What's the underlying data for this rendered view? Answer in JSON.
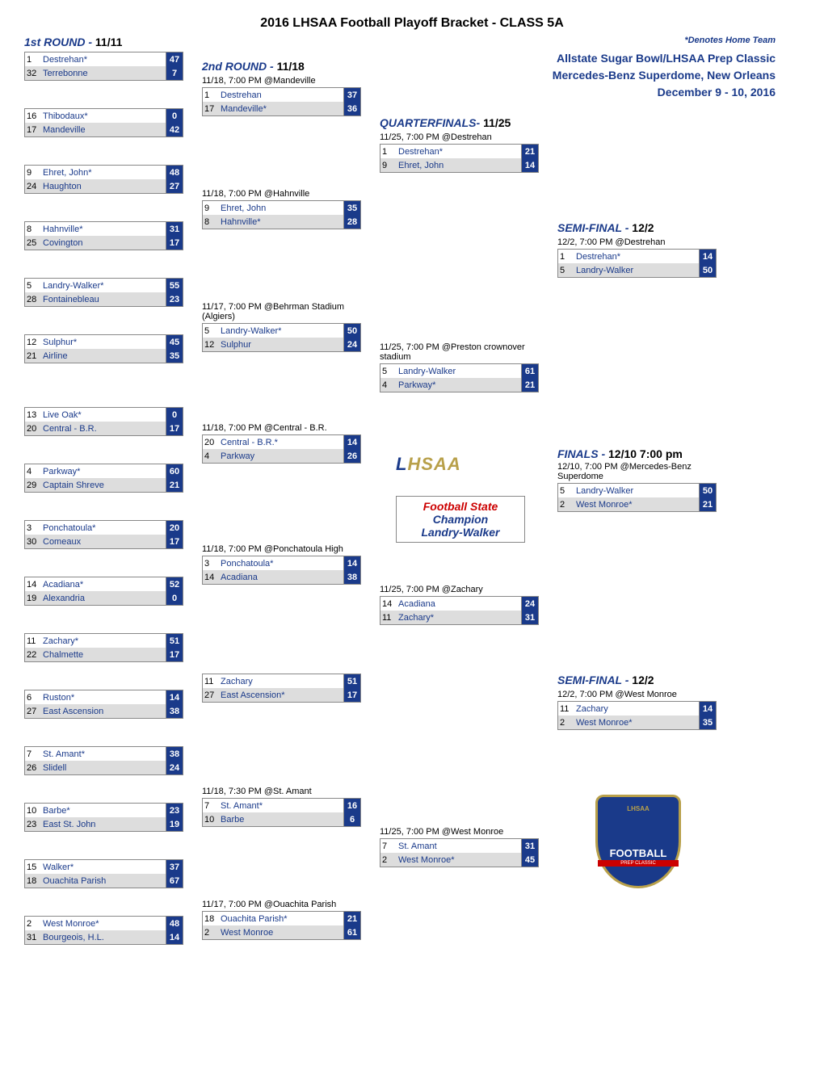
{
  "title": "2016 LHSAA Football Playoff Bracket - CLASS 5A",
  "home_note": "*Denotes Home Team",
  "event": {
    "line1": "Allstate Sugar Bowl/LHSAA Prep Classic",
    "line2": "Mercedes-Benz Superdome, New Orleans",
    "line3": "December 9 - 10, 2016"
  },
  "rounds": {
    "r1": {
      "label": "1st ROUND - ",
      "date": "11/11"
    },
    "r2": {
      "label": "2nd ROUND - ",
      "date": "11/18"
    },
    "qf": {
      "label": "QUARTERFINALS- ",
      "date": "11/25"
    },
    "sf": {
      "label": "SEMI-FINAL - ",
      "date": "12/2"
    },
    "f": {
      "label": "FINALS - ",
      "date": "12/10 7:00 pm"
    }
  },
  "champion": {
    "line1": "Football State",
    "line2": "Champion",
    "line3": "Landry-Walker"
  },
  "r1_games": [
    {
      "t1": {
        "seed": "1",
        "name": "Destrehan*",
        "score": "47"
      },
      "t2": {
        "seed": "32",
        "name": "Terrebonne",
        "score": "7"
      }
    },
    {
      "t1": {
        "seed": "16",
        "name": "Thibodaux*",
        "score": "0"
      },
      "t2": {
        "seed": "17",
        "name": "Mandeville",
        "score": "42"
      }
    },
    {
      "t1": {
        "seed": "9",
        "name": "Ehret, John*",
        "score": "48"
      },
      "t2": {
        "seed": "24",
        "name": "Haughton",
        "score": "27"
      }
    },
    {
      "t1": {
        "seed": "8",
        "name": "Hahnville*",
        "score": "31"
      },
      "t2": {
        "seed": "25",
        "name": "Covington",
        "score": "17"
      }
    },
    {
      "t1": {
        "seed": "5",
        "name": "Landry-Walker*",
        "score": "55"
      },
      "t2": {
        "seed": "28",
        "name": "Fontainebleau",
        "score": "23"
      }
    },
    {
      "t1": {
        "seed": "12",
        "name": "Sulphur*",
        "score": "45"
      },
      "t2": {
        "seed": "21",
        "name": "Airline",
        "score": "35"
      }
    },
    {
      "t1": {
        "seed": "13",
        "name": "Live Oak*",
        "score": "0"
      },
      "t2": {
        "seed": "20",
        "name": "Central - B.R.",
        "score": "17"
      }
    },
    {
      "t1": {
        "seed": "4",
        "name": "Parkway*",
        "score": "60"
      },
      "t2": {
        "seed": "29",
        "name": "Captain Shreve",
        "score": "21"
      }
    },
    {
      "t1": {
        "seed": "3",
        "name": "Ponchatoula*",
        "score": "20"
      },
      "t2": {
        "seed": "30",
        "name": "Comeaux",
        "score": "17"
      }
    },
    {
      "t1": {
        "seed": "14",
        "name": "Acadiana*",
        "score": "52"
      },
      "t2": {
        "seed": "19",
        "name": "Alexandria",
        "score": "0"
      }
    },
    {
      "t1": {
        "seed": "11",
        "name": "Zachary*",
        "score": "51"
      },
      "t2": {
        "seed": "22",
        "name": "Chalmette",
        "score": "17"
      }
    },
    {
      "t1": {
        "seed": "6",
        "name": "Ruston*",
        "score": "14"
      },
      "t2": {
        "seed": "27",
        "name": "East Ascension",
        "score": "38"
      }
    },
    {
      "t1": {
        "seed": "7",
        "name": "St. Amant*",
        "score": "38"
      },
      "t2": {
        "seed": "26",
        "name": "Slidell",
        "score": "24"
      }
    },
    {
      "t1": {
        "seed": "10",
        "name": "Barbe*",
        "score": "23"
      },
      "t2": {
        "seed": "23",
        "name": "East St. John",
        "score": "19"
      }
    },
    {
      "t1": {
        "seed": "15",
        "name": "Walker*",
        "score": "37"
      },
      "t2": {
        "seed": "18",
        "name": "Ouachita Parish",
        "score": "67"
      }
    },
    {
      "t1": {
        "seed": "2",
        "name": "West Monroe*",
        "score": "48"
      },
      "t2": {
        "seed": "31",
        "name": "Bourgeois, H.L.",
        "score": "14"
      }
    }
  ],
  "r2_games": [
    {
      "info": "11/18, 7:00 PM @Mandeville",
      "t1": {
        "seed": "1",
        "name": "Destrehan",
        "score": "37"
      },
      "t2": {
        "seed": "17",
        "name": "Mandeville*",
        "score": "36"
      }
    },
    {
      "info": "11/18, 7:00 PM @Hahnville",
      "t1": {
        "seed": "9",
        "name": "Ehret, John",
        "score": "35"
      },
      "t2": {
        "seed": "8",
        "name": "Hahnville*",
        "score": "28"
      }
    },
    {
      "info": "11/17, 7:00 PM @Behrman Stadium (Algiers)",
      "t1": {
        "seed": "5",
        "name": "Landry-Walker*",
        "score": "50"
      },
      "t2": {
        "seed": "12",
        "name": "Sulphur",
        "score": "24"
      }
    },
    {
      "info": "11/18, 7:00 PM @Central - B.R.",
      "t1": {
        "seed": "20",
        "name": "Central - B.R.*",
        "score": "14"
      },
      "t2": {
        "seed": "4",
        "name": "Parkway",
        "score": "26"
      }
    },
    {
      "info": "11/18, 7:00 PM @Ponchatoula High",
      "t1": {
        "seed": "3",
        "name": "Ponchatoula*",
        "score": "14"
      },
      "t2": {
        "seed": "14",
        "name": "Acadiana",
        "score": "38"
      }
    },
    {
      "info": "",
      "t1": {
        "seed": "11",
        "name": "Zachary",
        "score": "51"
      },
      "t2": {
        "seed": "27",
        "name": "East Ascension*",
        "score": "17"
      }
    },
    {
      "info": "11/18, 7:30 PM @St. Amant",
      "t1": {
        "seed": "7",
        "name": "St. Amant*",
        "score": "16"
      },
      "t2": {
        "seed": "10",
        "name": "Barbe",
        "score": "6"
      }
    },
    {
      "info": "11/17, 7:00 PM @Ouachita Parish",
      "t1": {
        "seed": "18",
        "name": "Ouachita Parish*",
        "score": "21"
      },
      "t2": {
        "seed": "2",
        "name": "West Monroe",
        "score": "61"
      }
    }
  ],
  "qf_games": [
    {
      "info": "11/25, 7:00 PM @Destrehan",
      "t1": {
        "seed": "1",
        "name": "Destrehan*",
        "score": "21"
      },
      "t2": {
        "seed": "9",
        "name": "Ehret, John",
        "score": "14"
      }
    },
    {
      "info": "11/25, 7:00 PM @Preston crownover stadium",
      "t1": {
        "seed": "5",
        "name": "Landry-Walker",
        "score": "61"
      },
      "t2": {
        "seed": "4",
        "name": "Parkway*",
        "score": "21"
      }
    },
    {
      "info": "11/25, 7:00 PM @Zachary",
      "t1": {
        "seed": "14",
        "name": "Acadiana",
        "score": "24"
      },
      "t2": {
        "seed": "11",
        "name": "Zachary*",
        "score": "31"
      }
    },
    {
      "info": "11/25, 7:00 PM @West Monroe",
      "t1": {
        "seed": "7",
        "name": "St. Amant",
        "score": "31"
      },
      "t2": {
        "seed": "2",
        "name": "West Monroe*",
        "score": "45"
      }
    }
  ],
  "sf_games": [
    {
      "info": "12/2, 7:00 PM @Destrehan",
      "t1": {
        "seed": "1",
        "name": "Destrehan*",
        "score": "14"
      },
      "t2": {
        "seed": "5",
        "name": "Landry-Walker",
        "score": "50"
      }
    },
    {
      "info": "12/2, 7:00 PM @West Monroe",
      "t1": {
        "seed": "11",
        "name": "Zachary",
        "score": "14"
      },
      "t2": {
        "seed": "2",
        "name": "West Monroe*",
        "score": "35"
      }
    }
  ],
  "final_game": {
    "info": "12/10, 7:00 PM @Mercedes-Benz Superdome",
    "t1": {
      "seed": "5",
      "name": "Landry-Walker",
      "score": "50"
    },
    "t2": {
      "seed": "2",
      "name": "West Monroe*",
      "score": "21"
    }
  }
}
